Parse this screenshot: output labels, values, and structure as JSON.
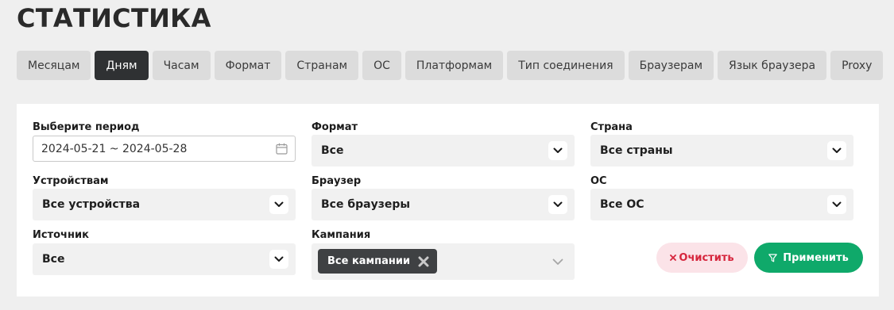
{
  "page_title": "СТАТИСТИКА",
  "tabs": [
    {
      "label": "Месяцам",
      "active": false
    },
    {
      "label": "Дням",
      "active": true
    },
    {
      "label": "Часам",
      "active": false
    },
    {
      "label": "Формат",
      "active": false
    },
    {
      "label": "Странам",
      "active": false
    },
    {
      "label": "ОС",
      "active": false
    },
    {
      "label": "Платформам",
      "active": false
    },
    {
      "label": "Тип соединения",
      "active": false
    },
    {
      "label": "Браузерам",
      "active": false
    },
    {
      "label": "Язык браузера",
      "active": false
    },
    {
      "label": "Proxy",
      "active": false
    }
  ],
  "filters": {
    "period": {
      "label": "Выберите период",
      "value": "2024-05-21 ~ 2024-05-28"
    },
    "format": {
      "label": "Формат",
      "value": "Все"
    },
    "country": {
      "label": "Страна",
      "value": "Все страны"
    },
    "devices": {
      "label": "Устройствам",
      "value": "Все устройства"
    },
    "browser": {
      "label": "Браузер",
      "value": "Все браузеры"
    },
    "os": {
      "label": "ОС",
      "value": "Все ОС"
    },
    "source": {
      "label": "Источник",
      "value": "Все"
    },
    "campaign": {
      "label": "Кампания",
      "chip": "Все кампании"
    }
  },
  "actions": {
    "clear_label": "Очистить",
    "apply_label": "Применить"
  },
  "colors": {
    "accent_green": "#0fa96a",
    "clear_red": "#d6263d",
    "active_tab": "#2f3133"
  }
}
